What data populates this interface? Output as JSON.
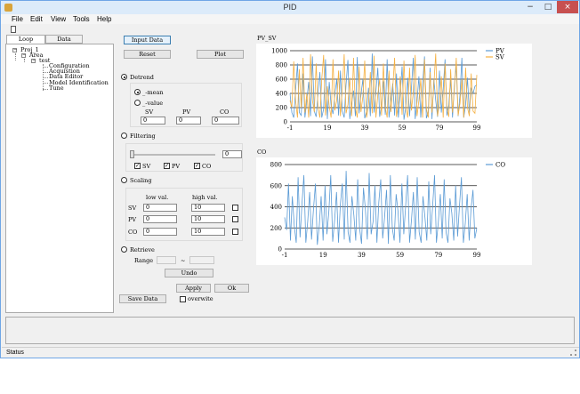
{
  "window": {
    "title": "PID",
    "minimize": "−",
    "maximize": "□",
    "close": "×"
  },
  "menu": [
    "File",
    "Edit",
    "View",
    "Tools",
    "Help"
  ],
  "tabs": [
    "Loop Manager",
    "Data Manager"
  ],
  "tree": {
    "root": "Proj_1",
    "area": "Area",
    "loop": "test",
    "children": [
      "Configuration",
      "Acquistion",
      "Data Editor",
      "Model Identification",
      "Tune"
    ]
  },
  "buttons": {
    "input_data": "Input Data",
    "reset": "Reset",
    "plot": "Plot",
    "undo": "Undo",
    "apply": "Apply",
    "ok": "Ok",
    "save_data": "Save Data"
  },
  "detrend": {
    "label": "Detrend",
    "mean_label": "_-mean",
    "value_label": "_-value",
    "cols": [
      "SV",
      "PV",
      "CO"
    ],
    "values": [
      "0",
      "0",
      "0"
    ]
  },
  "filtering": {
    "label": "Filtering",
    "value": "0",
    "checks": [
      "SV",
      "PV",
      "CO"
    ]
  },
  "scaling": {
    "label": "Scaling",
    "low_header": "low val.",
    "high_header": "high val.",
    "rows": [
      {
        "name": "SV",
        "low": "0",
        "high": "10"
      },
      {
        "name": "PV",
        "low": "0",
        "high": "10"
      },
      {
        "name": "CO",
        "low": "0",
        "high": "10"
      }
    ]
  },
  "retrieve": {
    "label": "Retrieve",
    "range_label": "Range",
    "dash": "~"
  },
  "overwrite_label": "overwite",
  "status": "Status",
  "colors": {
    "pv": "#5b9bd5",
    "sv": "#f5b041",
    "co": "#5b9bd5"
  },
  "chart_data": [
    {
      "type": "line",
      "title": "PV_SV",
      "ylim": [
        0,
        1000
      ],
      "yticks": [
        0,
        200,
        400,
        600,
        800,
        1000
      ],
      "xticks": [
        -1,
        19,
        39,
        59,
        79,
        99
      ],
      "xlim": [
        -1,
        99
      ],
      "grid": true,
      "legend": "top-right",
      "series": [
        {
          "name": "PV",
          "color": "#5b9bd5",
          "values": [
            400,
            130,
            60,
            450,
            820,
            130,
            90,
            680,
            60,
            300,
            560,
            80,
            920,
            150,
            70,
            400,
            700,
            60,
            180,
            880,
            40,
            560,
            230,
            110,
            380,
            600,
            90,
            720,
            150,
            60,
            520,
            870,
            40,
            250,
            440,
            80,
            910,
            120,
            380,
            600,
            50,
            150,
            480,
            80,
            960,
            130,
            420,
            760,
            70,
            240,
            570,
            100,
            880,
            60,
            300,
            540,
            90,
            680,
            60,
            380,
            780,
            30,
            200,
            620,
            80,
            470,
            900,
            40,
            280,
            640,
            60,
            520,
            920,
            50,
            140,
            760,
            40,
            600,
            300,
            70,
            720,
            130,
            460,
            880,
            90,
            240,
            600,
            60,
            520,
            780,
            80,
            380,
            900,
            60,
            240,
            620,
            120,
            480,
            400,
            500,
            520
          ]
        },
        {
          "name": "SV",
          "color": "#f5b041",
          "values": [
            300,
            200,
            850,
            300,
            60,
            740,
            200,
            900,
            130,
            400,
            60,
            950,
            300,
            140,
            820,
            200,
            60,
            600,
            940,
            90,
            500,
            220,
            60,
            880,
            160,
            300,
            720,
            80,
            460,
            950,
            120,
            240,
            620,
            80,
            900,
            200,
            60,
            780,
            140,
            360,
            860,
            60,
            240,
            700,
            120,
            930,
            60,
            380,
            600,
            90,
            820,
            210,
            60,
            720,
            140,
            480,
            900,
            70,
            260,
            640,
            100,
            860,
            200,
            60,
            760,
            160,
            420,
            940,
            80,
            300,
            600,
            60,
            880,
            190,
            60,
            700,
            130,
            520,
            960,
            80,
            260,
            640,
            60,
            820,
            200,
            70,
            740,
            130,
            460,
            900,
            90,
            260,
            600,
            60,
            760,
            200,
            80,
            680,
            150,
            120,
            660
          ]
        }
      ]
    },
    {
      "type": "line",
      "title": "CO",
      "ylim": [
        0,
        800
      ],
      "yticks": [
        0,
        200,
        400,
        600,
        800
      ],
      "xticks": [
        -1,
        19,
        39,
        59,
        79,
        99
      ],
      "xlim": [
        -1,
        99
      ],
      "grid": true,
      "legend": "top-right",
      "series": [
        {
          "name": "CO",
          "color": "#5b9bd5",
          "values": [
            300,
            180,
            620,
            80,
            500,
            220,
            60,
            680,
            110,
            420,
            700,
            60,
            260,
            540,
            90,
            380,
            620,
            40,
            220,
            500,
            80,
            600,
            140,
            360,
            700,
            70,
            280,
            540,
            60,
            420,
            620,
            90,
            740,
            160,
            60,
            500,
            320,
            80,
            660,
            200,
            50,
            580,
            380,
            90,
            720,
            140,
            260,
            600,
            60,
            440,
            660,
            100,
            300,
            560,
            50,
            700,
            200,
            80,
            520,
            360,
            60,
            620,
            140,
            420,
            700,
            60,
            280,
            540,
            90,
            680,
            160,
            60,
            500,
            300,
            80,
            640,
            140,
            400,
            700,
            60,
            260,
            520,
            100,
            660,
            160,
            60,
            480,
            340,
            80,
            600,
            120,
            420,
            680,
            60,
            240,
            520,
            80,
            380,
            560,
            100,
            200
          ]
        }
      ]
    }
  ]
}
